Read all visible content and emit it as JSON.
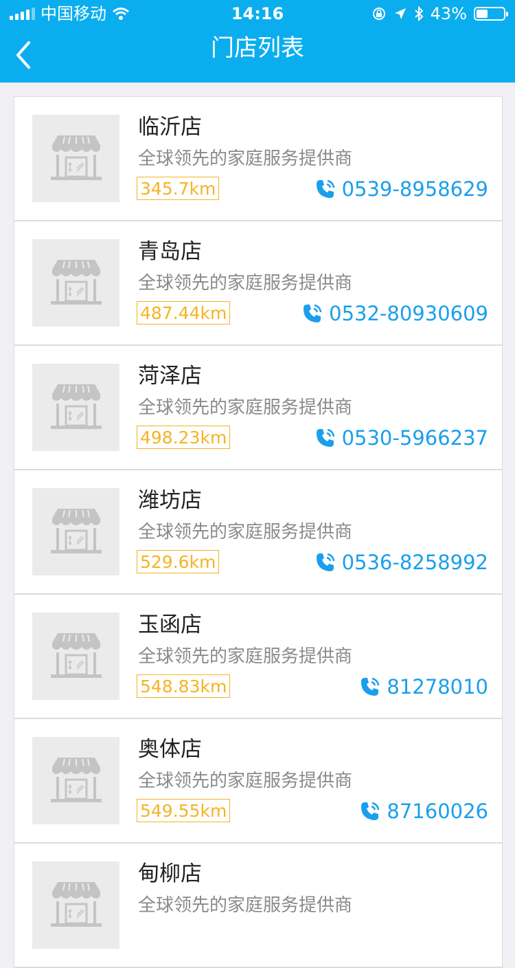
{
  "status_bar": {
    "carrier": "中国移动",
    "time": "14:16",
    "battery": "43%",
    "battery_level": 0.43
  },
  "header": {
    "title": "门店列表",
    "back_icon": "chevron-left-icon"
  },
  "colors": {
    "header": "#0aaeef",
    "distance": "#f5b323",
    "phone": "#1a9fec"
  },
  "stores": [
    {
      "name": "临沂店",
      "desc": "全球领先的家庭服务提供商",
      "distance": "345.7km",
      "phone": "0539-8958629"
    },
    {
      "name": "青岛店",
      "desc": "全球领先的家庭服务提供商",
      "distance": "487.44km",
      "phone": "0532-80930609"
    },
    {
      "name": "菏泽店",
      "desc": "全球领先的家庭服务提供商",
      "distance": "498.23km",
      "phone": "0530-5966237"
    },
    {
      "name": "潍坊店",
      "desc": "全球领先的家庭服务提供商",
      "distance": "529.6km",
      "phone": "0536-8258992"
    },
    {
      "name": "玉函店",
      "desc": "全球领先的家庭服务提供商",
      "distance": "548.83km",
      "phone": "81278010"
    },
    {
      "name": "奥体店",
      "desc": "全球领先的家庭服务提供商",
      "distance": "549.55km",
      "phone": "87160026"
    },
    {
      "name": "甸柳店",
      "desc": "全球领先的家庭服务提供商",
      "distance": "",
      "phone": ""
    }
  ]
}
